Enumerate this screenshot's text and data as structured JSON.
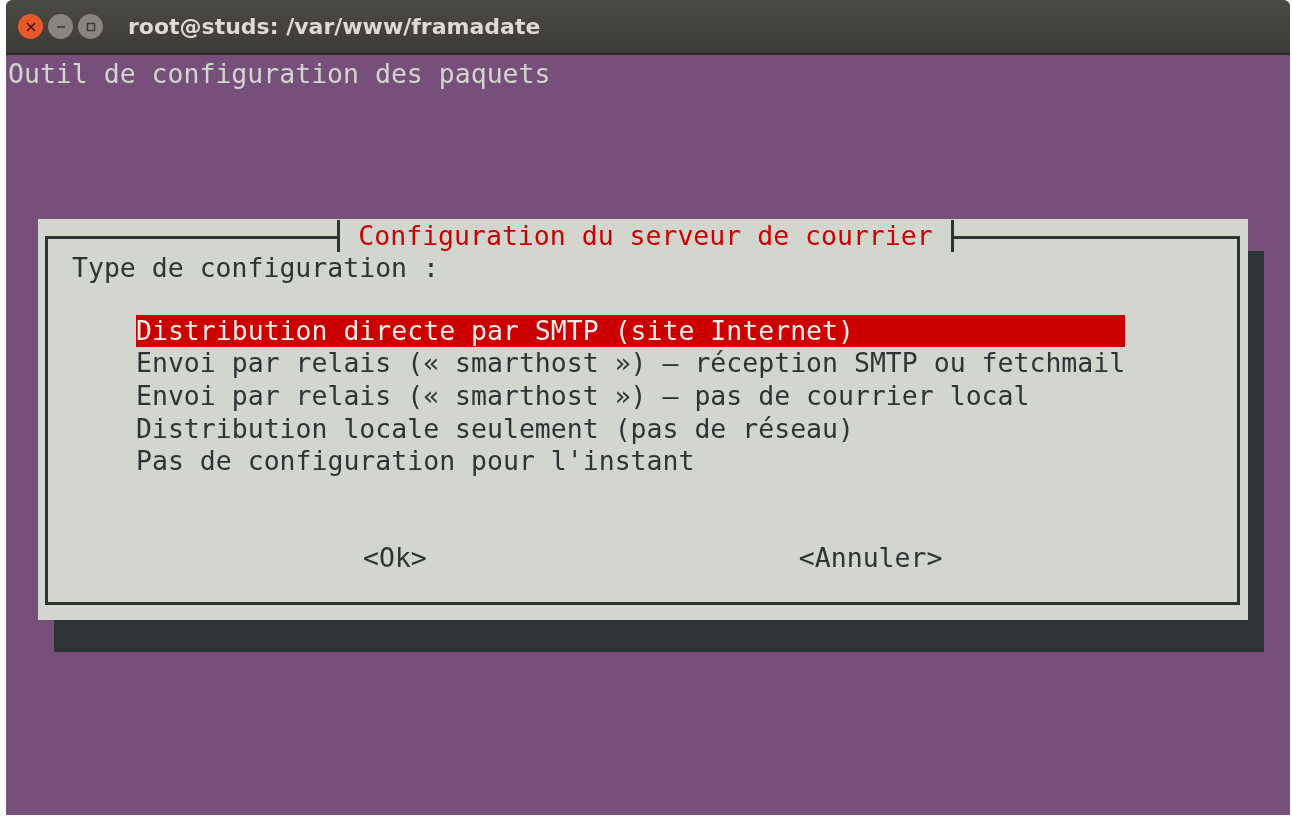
{
  "window": {
    "title": "root@studs: /var/www/framadate"
  },
  "terminal": {
    "header": "Outil de configuration des paquets"
  },
  "dialog": {
    "title": "Configuration du serveur de courrier",
    "prompt": "Type de configuration :",
    "options": [
      {
        "label": "Distribution directe par SMTP (site Internet)",
        "selected": true
      },
      {
        "label": "Envoi par relais (« smarthost ») — réception SMTP ou fetchmail",
        "selected": false
      },
      {
        "label": "Envoi par relais (« smarthost ») — pas de courrier local",
        "selected": false
      },
      {
        "label": "Distribution locale seulement (pas de réseau)",
        "selected": false
      },
      {
        "label": "Pas de configuration pour l'instant",
        "selected": false
      }
    ],
    "buttons": [
      "<Ok>",
      "<Annuler>"
    ]
  }
}
